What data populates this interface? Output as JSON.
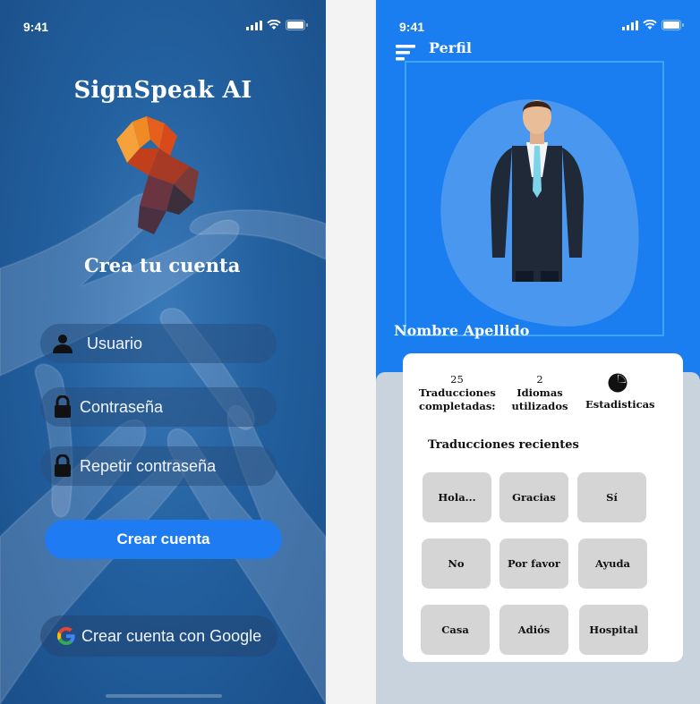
{
  "left": {
    "status_time": "9:41",
    "app_title": "SignSpeak AI",
    "heading": "Crea tu cuenta",
    "fields": {
      "usuario": "Usuario",
      "contrasena": "Contraseña",
      "repetir": "Repetir contraseña"
    },
    "create_button": "Crear cuenta",
    "google_button": "Crear cuenta con Google"
  },
  "right": {
    "status_time": "9:41",
    "header_title": "Perfil",
    "profile_name": "Nombre Apellido",
    "stats": {
      "translations_count": "25",
      "translations_label_1": "Traducciones",
      "translations_label_2": "completadas:",
      "languages_count": "2",
      "languages_label_1": "Idiomas",
      "languages_label_2": "utilizados",
      "statistics_label": "Estadisticas"
    },
    "recent_title": "Traducciones recientes",
    "recent_items": [
      "Hola...",
      "Gracias",
      "Sí",
      "No",
      "Por favor",
      "Ayuda",
      "Casa",
      "Adiós",
      "Hospital"
    ]
  },
  "colors": {
    "left_bg": "#23609f",
    "right_bg": "#1a7df0",
    "button_blue": "#1e7bf2",
    "panel_gray": "#c9d3de",
    "chip_gray": "#d5d5d5"
  }
}
